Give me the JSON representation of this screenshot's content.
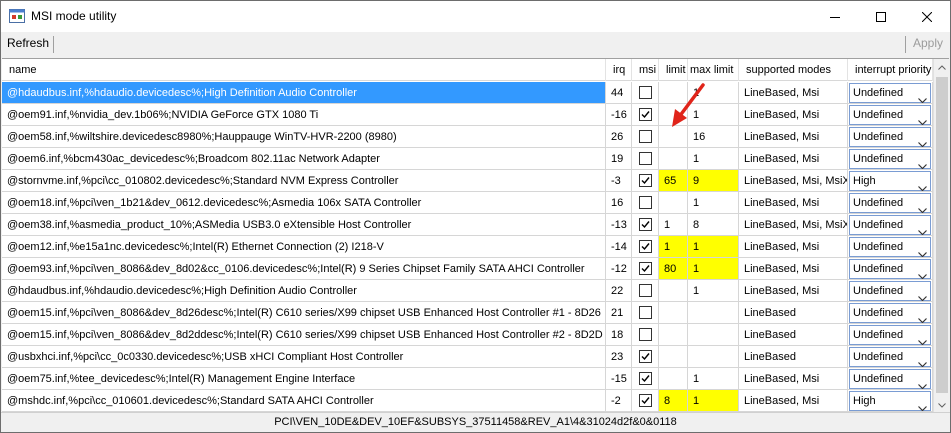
{
  "window": {
    "title": "MSI mode utility"
  },
  "toolbar": {
    "refresh_label": "Refresh",
    "apply_label": "Apply"
  },
  "columns": {
    "name": "name",
    "irq": "irq",
    "msi": "msi",
    "limit": "limit",
    "max_limit": "max limit",
    "supported_modes": "supported modes",
    "interrupt_priority": "interrupt priority"
  },
  "highlight_color": "#ffff00",
  "selection_color": "#3399ff",
  "annotation_color": "#e0241a",
  "rows": [
    {
      "name": "@hdaudbus.inf,%hdaudio.devicedesc%;High Definition Audio Controller",
      "irq": "44",
      "msi": false,
      "limit": "",
      "max_limit": "1",
      "modes": "LineBased, Msi",
      "priority": "Undefined",
      "selected": true,
      "hl": false
    },
    {
      "name": "@oem91.inf,%nvidia_dev.1b06%;NVIDIA GeForce GTX 1080 Ti",
      "irq": "-16",
      "msi": true,
      "limit": "",
      "max_limit": "1",
      "modes": "LineBased, Msi",
      "priority": "Undefined",
      "selected": false,
      "hl": false
    },
    {
      "name": "@oem58.inf,%wiltshire.devicedesc8980%;Hauppauge WinTV-HVR-2200 (8980)",
      "irq": "26",
      "msi": false,
      "limit": "",
      "max_limit": "16",
      "modes": "LineBased, Msi",
      "priority": "Undefined",
      "selected": false,
      "hl": false
    },
    {
      "name": "@oem6.inf,%bcm430ac_devicedesc%;Broadcom 802.11ac Network Adapter",
      "irq": "19",
      "msi": false,
      "limit": "",
      "max_limit": "1",
      "modes": "LineBased, Msi",
      "priority": "Undefined",
      "selected": false,
      "hl": false
    },
    {
      "name": "@stornvme.inf,%pci\\cc_010802.devicedesc%;Standard NVM Express Controller",
      "irq": "-3",
      "msi": true,
      "limit": "65",
      "max_limit": "9",
      "modes": "LineBased, Msi, MsiX",
      "priority": "High",
      "selected": false,
      "hl": true
    },
    {
      "name": "@oem18.inf,%pci\\ven_1b21&dev_0612.devicedesc%;Asmedia 106x SATA Controller",
      "irq": "16",
      "msi": false,
      "limit": "",
      "max_limit": "1",
      "modes": "LineBased, Msi",
      "priority": "Undefined",
      "selected": false,
      "hl": false
    },
    {
      "name": "@oem38.inf,%asmedia_product_10%;ASMedia USB3.0 eXtensible Host Controller",
      "irq": "-13",
      "msi": true,
      "limit": "1",
      "max_limit": "8",
      "modes": "LineBased, Msi, MsiX",
      "priority": "Undefined",
      "selected": false,
      "hl": false
    },
    {
      "name": "@oem12.inf,%e15a1nc.devicedesc%;Intel(R) Ethernet Connection (2) I218-V",
      "irq": "-14",
      "msi": true,
      "limit": "1",
      "max_limit": "1",
      "modes": "LineBased, Msi",
      "priority": "Undefined",
      "selected": false,
      "hl": true
    },
    {
      "name": "@oem93.inf,%pci\\ven_8086&dev_8d02&cc_0106.devicedesc%;Intel(R) 9 Series Chipset Family SATA AHCI Controller",
      "irq": "-12",
      "msi": true,
      "limit": "80",
      "max_limit": "1",
      "modes": "LineBased, Msi",
      "priority": "Undefined",
      "selected": false,
      "hl": true
    },
    {
      "name": "@hdaudbus.inf,%hdaudio.devicedesc%;High Definition Audio Controller",
      "irq": "22",
      "msi": false,
      "limit": "",
      "max_limit": "1",
      "modes": "LineBased, Msi",
      "priority": "Undefined",
      "selected": false,
      "hl": false
    },
    {
      "name": "@oem15.inf,%pci\\ven_8086&dev_8d26desc%;Intel(R) C610 series/X99 chipset USB Enhanced Host Controller #1 - 8D26",
      "irq": "21",
      "msi": false,
      "limit": "",
      "max_limit": "",
      "modes": "LineBased",
      "priority": "Undefined",
      "selected": false,
      "hl": false
    },
    {
      "name": "@oem15.inf,%pci\\ven_8086&dev_8d2ddesc%;Intel(R) C610 series/X99 chipset USB Enhanced Host Controller #2 - 8D2D",
      "irq": "18",
      "msi": false,
      "limit": "",
      "max_limit": "",
      "modes": "LineBased",
      "priority": "Undefined",
      "selected": false,
      "hl": false
    },
    {
      "name": "@usbxhci.inf,%pci\\cc_0c0330.devicedesc%;USB xHCI Compliant Host Controller",
      "irq": "23",
      "msi": true,
      "limit": "",
      "max_limit": "",
      "modes": "LineBased",
      "priority": "Undefined",
      "selected": false,
      "hl": false
    },
    {
      "name": "@oem75.inf,%tee_devicedesc%;Intel(R) Management Engine Interface",
      "irq": "-15",
      "msi": true,
      "limit": "",
      "max_limit": "1",
      "modes": "LineBased, Msi",
      "priority": "Undefined",
      "selected": false,
      "hl": false
    },
    {
      "name": "@mshdc.inf,%pci\\cc_010601.devicedesc%;Standard SATA AHCI Controller",
      "irq": "-2",
      "msi": true,
      "limit": "8",
      "max_limit": "1",
      "modes": "LineBased, Msi",
      "priority": "High",
      "selected": false,
      "hl": true
    }
  ],
  "status": {
    "text": "PCI\\VEN_10DE&DEV_10EF&SUBSYS_37511458&REV_A1\\4&31024d2f&0&0118"
  }
}
